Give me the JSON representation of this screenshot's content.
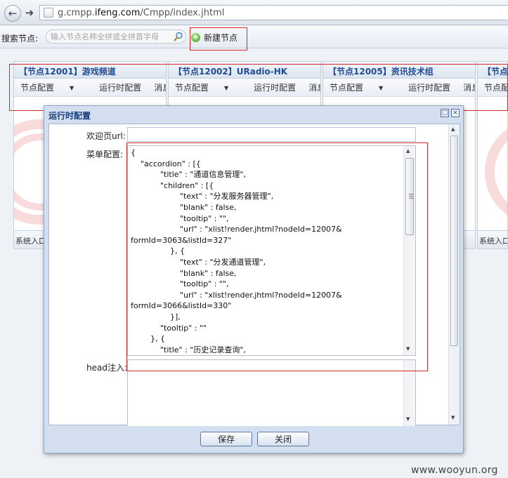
{
  "browser": {
    "url_prefix": "g.cmpp.",
    "url_host": "ifeng.com",
    "url_path": "/Cmpp/index.jhtml"
  },
  "toolbar": {
    "search_label": "搜索节点:",
    "search_placeholder": "输入节点名称全拼或全拼首字母",
    "new_node_label": "新建节点"
  },
  "nodes": [
    {
      "title": "【节点12001】游戏频道",
      "menu": [
        "节点配置",
        "运行时配置",
        "消息"
      ],
      "footer": "系统入口"
    },
    {
      "title": "【节点12002】URadio-HK",
      "menu": [
        "节点配置",
        "运行时配置",
        "消息"
      ],
      "footer": ""
    },
    {
      "title": "【节点12005】资讯技术组",
      "menu": [
        "节点配置",
        "运行时配置",
        "消息"
      ],
      "footer": ""
    },
    {
      "title": "【节点",
      "menu": [
        "节点配"
      ],
      "footer": "系统入口"
    }
  ],
  "modal": {
    "title": "运行时配置",
    "welcome_url_label": "欢迎页url:",
    "menu_config_label": "菜单配置:",
    "head_inject_label": "head注入:",
    "menu_config_value": "{\n\t\"accordion\" : [{\n\t\t\t\"title\" : \"通道信息管理\",\n\t\t\t\"children\" : [{\n\t\t\t\t\t\"text\" : \"分发服务器管理\",\n\t\t\t\t\t\"blank\" : false,\n\t\t\t\t\t\"tooltip\" : \"\",\n\t\t\t\t\t\"url\" : \"xlist!render.jhtml?nodeId=12007&\nformId=3063&listId=327\"\n\t\t\t\t}, {\n\t\t\t\t\t\"text\" : \"分发通道管理\",\n\t\t\t\t\t\"blank\" : false,\n\t\t\t\t\t\"tooltip\" : \"\",\n\t\t\t\t\t\"url\" : \"xlist!render.jhtml?nodeId=12007&\nformId=3066&listId=330\"\n\t\t\t\t}],\n\t\t\t\"tooltip\" : \"\"\n\t\t}, {\n\t\t\t\"title\" : \"历史记录查询\",",
    "save_label": "保存",
    "close_label": "关闭"
  },
  "watermark": "www.wooyun.org",
  "colors": {
    "highlight_box": "#d8262d",
    "node_title": "#1f4c94"
  }
}
